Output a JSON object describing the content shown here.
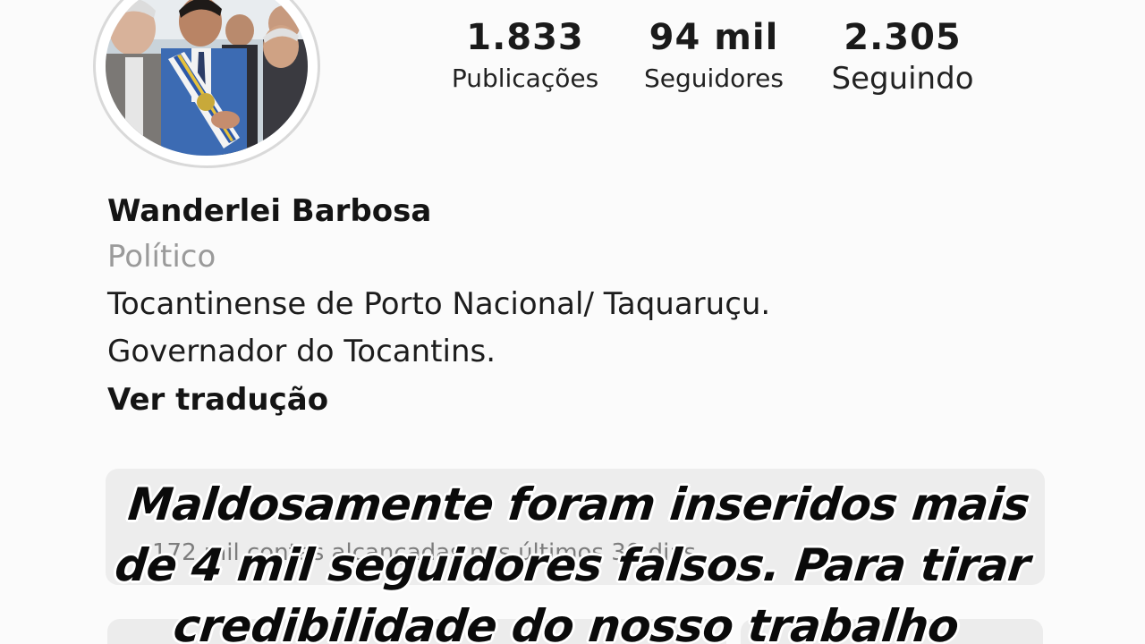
{
  "profile": {
    "avatar_icon": "profile-photo",
    "stats": [
      {
        "value": "1.833",
        "label": "Publicações"
      },
      {
        "value": "94 mil",
        "label": "Seguidores"
      },
      {
        "value": "2.305",
        "label": "Seguindo"
      }
    ],
    "name": "Wanderlei Barbosa",
    "category": "Político",
    "bio_lines": [
      "Tocantinense de Porto Nacional/ Taquaruçu.",
      "Governador do Tocantins."
    ],
    "translate_label": "Ver tradução"
  },
  "dashboard": {
    "reach_text": "172 mil contas alcançadas nos últimos 30 dias."
  },
  "caption": {
    "lines": [
      "Maldosamente foram inseridos mais",
      "de 4 mil seguidores falsos. Para tirar",
      "credibilidade do nosso trabalho"
    ]
  },
  "colors": {
    "background": "#fbfbfb",
    "category_gray": "#9a9a9a",
    "card_gray": "#ededed",
    "caption_text": "#0a0a0a",
    "caption_outline": "#ffffff"
  }
}
